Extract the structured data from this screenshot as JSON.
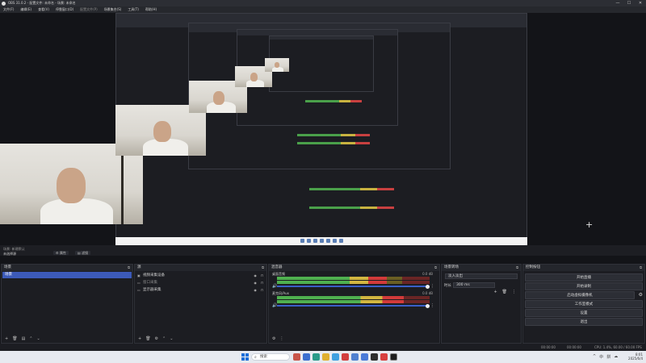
{
  "app": {
    "title": "OBS 31.0.2 - 配置文件: 未命名 - 场景: 未命名",
    "window_controls": [
      "—",
      "☐",
      "✕"
    ]
  },
  "menu": [
    "文件(F)",
    "编辑(E)",
    "查看(V)",
    "停靠窗口(D)",
    "配置文件(P)",
    "场景集合(S)",
    "工具(T)",
    "帮助(H)"
  ],
  "scene_strip": {
    "label_top": "场景: 新建默认",
    "current_scene": "未选择源",
    "tag_properties": "⚙ 属性",
    "tag_filters": "▤ 滤镜"
  },
  "docks": {
    "scenes": {
      "title": "场景",
      "items": [
        "场景"
      ]
    },
    "sources": {
      "title": "源",
      "items": [
        {
          "name": "视频采集设备",
          "icon": "camera-icon",
          "dim": false
        },
        {
          "name": "窗口采集",
          "icon": "window-icon",
          "dim": true
        },
        {
          "name": "显示器采集",
          "icon": "monitor-icon",
          "dim": false
        }
      ]
    },
    "mixer": {
      "title": "混音器",
      "channels": [
        {
          "name": "桌面音频",
          "db": "0.0 dB",
          "level": 0.72
        },
        {
          "name": "麦克风/Aux",
          "db": "0.0 dB",
          "level": 0.83
        }
      ]
    },
    "transitions": {
      "title": "场景转场",
      "selected": "淡入淡出",
      "duration_label": "时长",
      "duration": "300 ms"
    },
    "controls": {
      "title": "控制按钮",
      "buttons": [
        "开始直播",
        "开始录制",
        "启动虚拟摄像机",
        "工作室模式",
        "设置",
        "退出"
      ]
    }
  },
  "statusbar": {
    "rec_time": "00:00:00",
    "stream_time": "00:00:00",
    "cpu_fps": "CPU: 1.4%, 60.00 / 60.00 FPS"
  },
  "taskbar": {
    "search_placeholder": "搜索",
    "time": "8:01",
    "date": "2025/6/4",
    "tray_icons": [
      "^",
      "中",
      "拼",
      "☁"
    ]
  },
  "colors": {
    "accent": "#3c5ab8",
    "meter_green": "#4fb04f",
    "meter_yellow": "#d2b640",
    "meter_red": "#d23a3a",
    "background": "#131418"
  }
}
